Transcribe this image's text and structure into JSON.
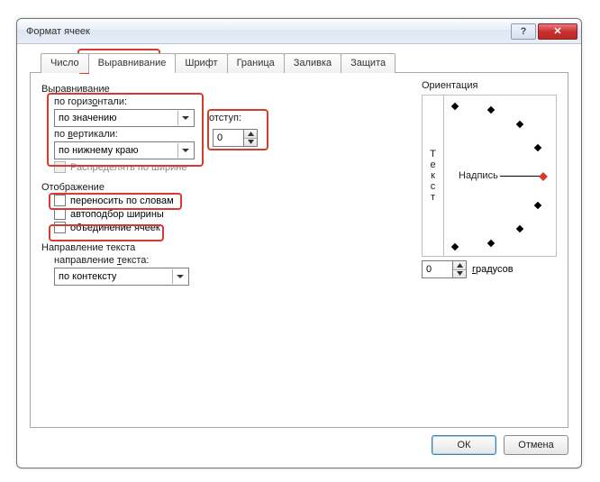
{
  "window": {
    "title": "Формат ячеек"
  },
  "tabs": {
    "t0": "Число",
    "t1": "Выравнивание",
    "t2": "Шрифт",
    "t3": "Граница",
    "t4": "Заливка",
    "t5": "Защита"
  },
  "alignment": {
    "group_label": "Выравнивание",
    "horizontal_label": "по горизонтали:",
    "horizontal_value": "по значению",
    "indent_label": "отступ:",
    "indent_value": "0",
    "vertical_label": "по вертикали:",
    "vertical_value": "по нижнему краю",
    "distribute_label": "Распределять по ширине"
  },
  "display": {
    "group_label": "Отображение",
    "wrap_label": "переносить по словам",
    "shrink_label": "автоподбор ширины",
    "merge_label": "объединение ячеек"
  },
  "direction": {
    "group_label": "Направление текста",
    "label": "направление текста:",
    "value": "по контексту"
  },
  "orientation": {
    "group_label": "Ориентация",
    "vertical_text": "Текст",
    "dial_label": "Надпись",
    "degrees_value": "0",
    "degrees_label": "градусов"
  },
  "buttons": {
    "ok": "ОК",
    "cancel": "Отмена"
  },
  "titlebar": {
    "help": "?",
    "close": "✕"
  }
}
